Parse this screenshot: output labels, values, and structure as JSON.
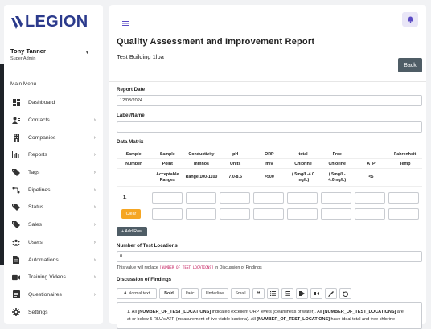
{
  "app": {
    "logo_text": "LEGION",
    "brand_color": "#2b3a8c"
  },
  "user": {
    "name": "Tony Tanner",
    "role": "Super Admin"
  },
  "sidebar": {
    "menu_title": "Main Menu",
    "items": [
      {
        "label": "Dashboard",
        "icon": "dashboard-icon",
        "chevron": false
      },
      {
        "label": "Contacts",
        "icon": "contacts-icon",
        "chevron": true
      },
      {
        "label": "Companies",
        "icon": "building-icon",
        "chevron": true
      },
      {
        "label": "Reports",
        "icon": "bar-chart-icon",
        "chevron": true
      },
      {
        "label": "Tags",
        "icon": "tag-icon",
        "chevron": true
      },
      {
        "label": "Pipelines",
        "icon": "pipeline-icon",
        "chevron": true
      },
      {
        "label": "Status",
        "icon": "status-tag-icon",
        "chevron": true
      },
      {
        "label": "Sales",
        "icon": "sales-tag-icon",
        "chevron": true
      },
      {
        "label": "Users",
        "icon": "users-icon",
        "chevron": true
      },
      {
        "label": "Automations",
        "icon": "document-icon",
        "chevron": true
      },
      {
        "label": "Training Videos",
        "icon": "video-camera-icon",
        "chevron": true
      },
      {
        "label": "Questionaires",
        "icon": "questionnaire-icon",
        "chevron": true
      },
      {
        "label": "Settings",
        "icon": "gear-icon",
        "chevron": false
      }
    ]
  },
  "header": {
    "title": "Quality Assessment and Improvement Report",
    "subtitle": "Test Building 1lba",
    "back_label": "Back"
  },
  "form": {
    "report_date_label": "Report Date",
    "report_date_value": "12/03/2024",
    "label_name_label": "Label/Name",
    "label_name_value": "",
    "data_matrix_label": "Data Matrix",
    "matrix_headers_1": [
      "Sample",
      "Sample",
      "Conductivity",
      "pH",
      "ORP",
      "total",
      "Free",
      "",
      "Fahrenheit"
    ],
    "matrix_headers_2": [
      "Number",
      "Point",
      "mmhos",
      "Units",
      "mlv",
      "Chlorine",
      "Chlorine",
      "ATP",
      "Temp"
    ],
    "matrix_ranges": [
      "",
      "Acceptable Ranges",
      "Range 100-1100",
      "7.0-8.5",
      ">500",
      "(.5mg/L-4.0 mg/L)",
      "(.5mg/L-4.0mg/L)",
      "<5",
      ""
    ],
    "row_number": "1.",
    "clear_label": "Clear",
    "add_row_label": "+ Add Row",
    "num_locations_label": "Number of Test Locations",
    "num_locations_value": "0",
    "note_prefix": "This value will replace",
    "note_token": "[NUMBER_OF_TEST_LOCATIONS]",
    "note_suffix": "in Discussion of Findings",
    "discussion_label": "Discussion of Findings"
  },
  "toolbar": {
    "style_select": "Normal text",
    "bold": "Bold",
    "italic": "Italic",
    "underline": "Underline",
    "small": "Small",
    "quote": "❝",
    "icons": [
      "bullet-list-icon",
      "numbered-list-icon",
      "indent-icon",
      "outdent-icon",
      "brush-icon",
      "undo-icon"
    ]
  },
  "editor": {
    "line1_a": "1. All ",
    "token1": "[NUMBER_OF_TEST_LOCATIONS]",
    "line1_b": " indicated excellent ORP levels (cleanliness of water). All ",
    "token2": "[NUMBER_OF_TEST_LOCATIONS]",
    "line1_c": " are",
    "line2_a": "at or below 5 RLU's ATP (measurement of live viable bacteria). All ",
    "token3": "[NUMBER_OF_TEST_LOCATIONS]",
    "line2_b": " have ideal total and free chlorine"
  },
  "colors": {
    "back_button": "#4f5d66",
    "clear_button": "#f5a623",
    "bell_bg": "#e9e6f7",
    "accent": "#5b4bc4"
  }
}
